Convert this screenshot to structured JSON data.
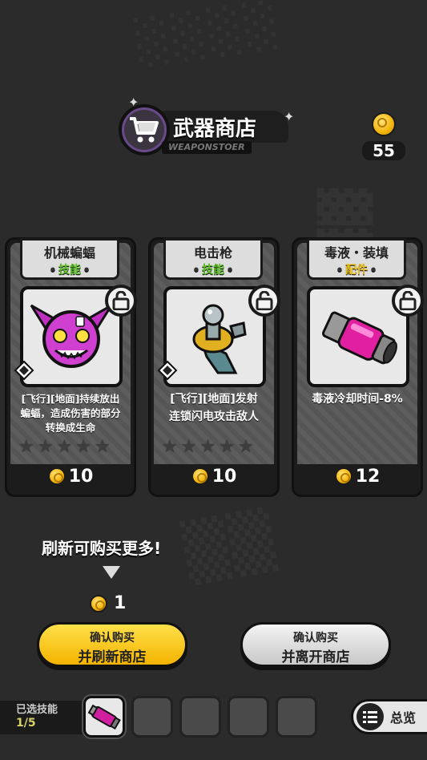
{
  "shop": {
    "title": "武器商店",
    "subtitle": "WEAPONSTOER",
    "cart_icon": "shopping-cart-icon"
  },
  "wallet": {
    "coins": "55",
    "icon": "coin-icon"
  },
  "cards": [
    {
      "name": "机械蝙蝠",
      "type": "技能",
      "type_color": "#5fbf2a",
      "desc_line1": "[飞行][地面]持续放出",
      "desc_line2": "蝙蝠，造成伤害的部分",
      "desc_line3": "转换成生命",
      "price": "10",
      "stars_filled": 0,
      "stars_total": 5,
      "icon": "mech-bat-icon"
    },
    {
      "name": "电击枪",
      "type": "技能",
      "type_color": "#5fbf2a",
      "desc_line1": "[飞行][地面]发射",
      "desc_line2": "连锁闪电攻击敌人",
      "desc_line3": "",
      "price": "10",
      "stars_filled": 0,
      "stars_total": 5,
      "icon": "tesla-gun-icon"
    },
    {
      "name": "毒液・装填",
      "type": "配件",
      "type_color": "#e8c020",
      "desc_line1": "毒液冷却时间-8%",
      "desc_line2": "",
      "desc_line3": "",
      "price": "12",
      "stars_filled": 0,
      "stars_total": 0,
      "icon": "venom-canister-icon"
    }
  ],
  "refresh": {
    "hint": "刷新可购买更多!",
    "cost": "1"
  },
  "buttons": {
    "refresh_l1": "确认购买",
    "refresh_l2": "并刷新商店",
    "leave_l1": "确认购买",
    "leave_l2": "并离开商店"
  },
  "bottom": {
    "skills_label": "已选技能",
    "skills_count": "1/5",
    "overview_label": "总览"
  },
  "colors": {
    "background": "#2b2b2b",
    "accent_yellow": "#f4b300",
    "skill_green": "#5fbf2a",
    "part_yellow": "#e8c020"
  }
}
